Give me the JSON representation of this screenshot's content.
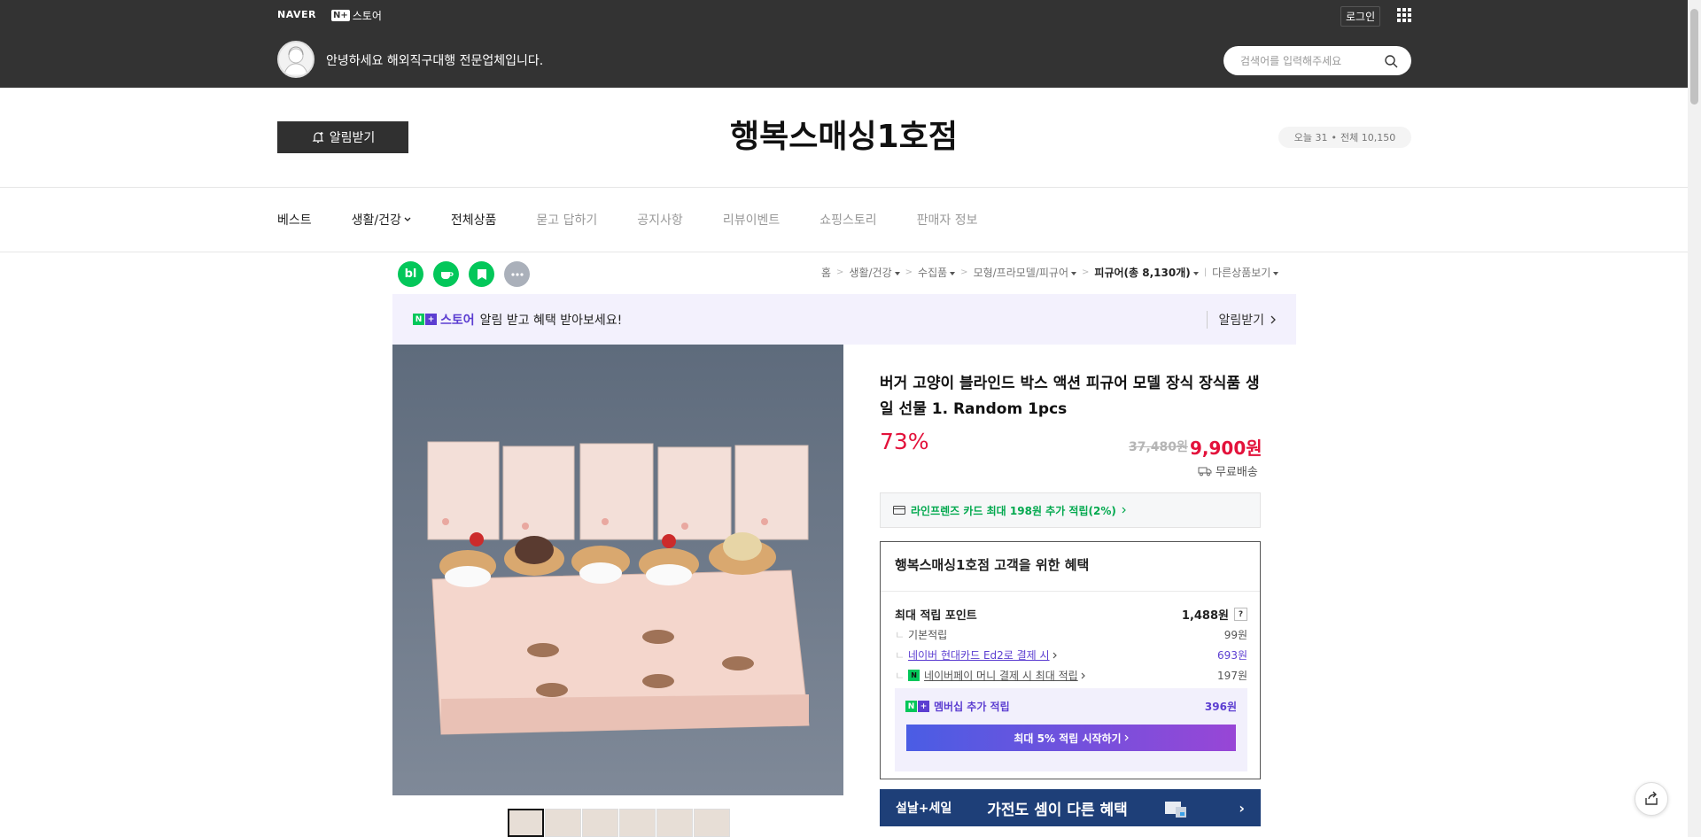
{
  "header": {
    "brand": "NAVER",
    "store_logo": "스토어",
    "np_badge": "N+",
    "login": "로그인",
    "greeting": "안녕하세요 해외직구대행 전문업체입니다.",
    "search_placeholder": "검색어를 입력해주세요"
  },
  "store": {
    "alarm_label": "알림받기",
    "title": "행복스매싱1호점",
    "visits_today": "오늘 31",
    "visits_sep": "•",
    "visits_total": "전체 10,150"
  },
  "nav": [
    {
      "label": "베스트"
    },
    {
      "label": "생활/건강"
    },
    {
      "label": "전체상품"
    },
    {
      "label": "묻고 답하기"
    },
    {
      "label": "공지사항"
    },
    {
      "label": "리뷰이벤트"
    },
    {
      "label": "쇼핑스토리"
    },
    {
      "label": "판매자 정보"
    }
  ],
  "share_icons": [
    "blog-icon",
    "cafe-icon",
    "bookmark-icon",
    "more-icon"
  ],
  "breadcrumb": {
    "home": "홈",
    "items": [
      "생활/건강",
      "수집품",
      "모형/프라모델/피규어"
    ],
    "current": "피규어",
    "current_count": "(총 8,130개)",
    "other": "다른상품보기"
  },
  "promo": {
    "store": "스토어",
    "text": "알림 받고 혜택 받아보세요!",
    "action": "알림받기"
  },
  "product": {
    "name": "버거 고양이 블라인드 박스 액션 피규어 모델 장식 장식품 생일 선물 1. Random 1pcs",
    "discount": "73%",
    "original_price": "37,480원",
    "price": "9,900원",
    "shipping": "무료배송",
    "card_offer": "라인프렌즈 카드 최대 198원 추가 적립(2%)",
    "thumbnail_count": 6
  },
  "benefit": {
    "title": "행복스매싱1호점 고객을 위한 혜택",
    "max_points_label": "최대 적립 포인트",
    "max_points_value": "1,488원",
    "question_mark": "?",
    "rows": [
      {
        "label": "기본적립",
        "value": "99원"
      },
      {
        "label": "네이버 현대카드 Ed2로 결제 시",
        "value": "693원"
      },
      {
        "label": "네이버페이 머니 결제 시 최대 적립",
        "value": "197원"
      }
    ],
    "membership_label": "멤버십 추가 적립",
    "membership_value": "396원",
    "membership_button": "최대 5% 적립 시작하기"
  },
  "banner": {
    "left": "설날+세일",
    "right": "가전도 셈이 다른 혜택"
  },
  "colors": {
    "header_bg": "#333333",
    "accent_red": "#e3123b",
    "naver_green": "#03c75a",
    "purple": "#5c3ed1"
  }
}
